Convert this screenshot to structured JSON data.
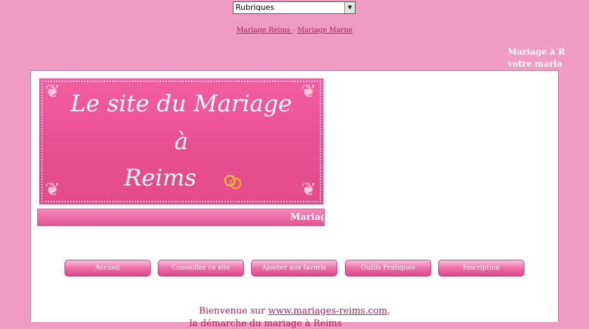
{
  "select": {
    "value": "Rubriques"
  },
  "top_links": [
    {
      "label": "Mariage Reims "
    },
    {
      "sep": " - "
    },
    {
      "label": "Mariage Marne"
    }
  ],
  "marquee": {
    "line1": "Mariage à R",
    "line2": "votre maria"
  },
  "banner": {
    "line1": "Le site du Mariage",
    "line2": "à",
    "line3": "Reims"
  },
  "subbar": {
    "text": "Mariag"
  },
  "nav": [
    {
      "label": "Accueil"
    },
    {
      "label": "Conseiller ce site"
    },
    {
      "label": "Ajouter aux favoris"
    },
    {
      "label": "Outils Pratiques"
    },
    {
      "label": "Inscription"
    }
  ],
  "welcome": {
    "prefix": "Bienvenue sur ",
    "link": "www.mariages-reims.com",
    "suffix": ",",
    "line2": "la démarche du mariage à Reims"
  }
}
